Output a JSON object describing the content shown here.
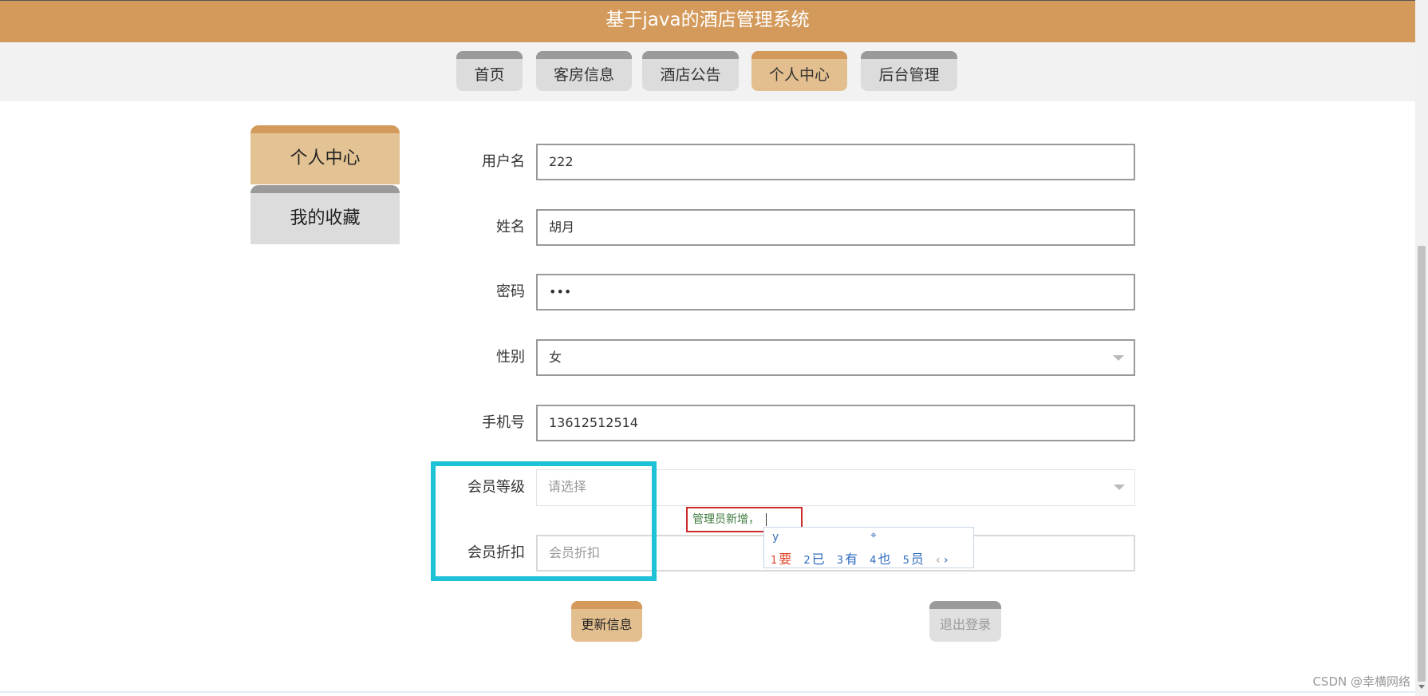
{
  "header": {
    "title": "基于java的酒店管理系统"
  },
  "nav": {
    "items": [
      {
        "label": "首页"
      },
      {
        "label": "客房信息"
      },
      {
        "label": "酒店公告"
      },
      {
        "label": "个人中心",
        "active": true
      },
      {
        "label": "后台管理"
      }
    ]
  },
  "sidebar": {
    "items": [
      {
        "label": "个人中心",
        "active": true
      },
      {
        "label": "我的收藏"
      }
    ]
  },
  "form": {
    "username": {
      "label": "用户名",
      "value": "222"
    },
    "name": {
      "label": "姓名",
      "value": "胡月"
    },
    "password": {
      "label": "密码",
      "value": "•••"
    },
    "gender": {
      "label": "性别",
      "value": "女"
    },
    "phone": {
      "label": "手机号",
      "value": "13612512514"
    },
    "member_level": {
      "label": "会员等级",
      "placeholder": "请选择"
    },
    "member_discount": {
      "label": "会员折扣",
      "placeholder": "会员折扣"
    }
  },
  "annotation": {
    "text": "管理员新增，"
  },
  "ime": {
    "composition": "y",
    "candidates": [
      {
        "num": "1",
        "text": "要"
      },
      {
        "num": "2",
        "text": "已"
      },
      {
        "num": "3",
        "text": "有"
      },
      {
        "num": "4",
        "text": "也"
      },
      {
        "num": "5",
        "text": "员"
      }
    ],
    "prev": "‹",
    "next": "›"
  },
  "actions": {
    "update_label": "更新信息",
    "logout_label": "退出登录"
  },
  "watermark": "CSDN @幸横网络",
  "colors": {
    "header_bg": "#d49a5c",
    "active_tab": "#e3bf8f",
    "highlight": "#1ec2d6"
  }
}
